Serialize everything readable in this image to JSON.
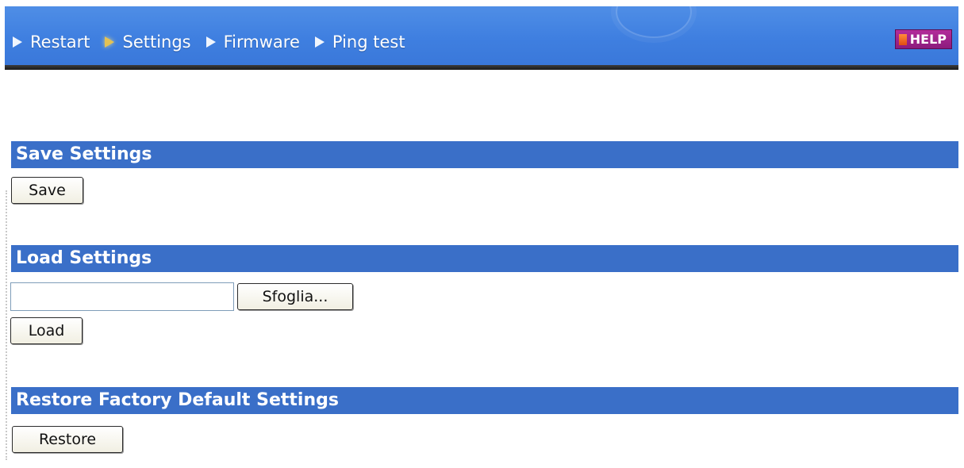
{
  "nav": {
    "items": [
      {
        "label": "Restart",
        "active": false
      },
      {
        "label": "Settings",
        "active": true
      },
      {
        "label": "Firmware",
        "active": false
      },
      {
        "label": "Ping test",
        "active": false
      }
    ],
    "help_label": "HELP"
  },
  "sections": {
    "save": {
      "title": "Save Settings",
      "button_label": "Save"
    },
    "load": {
      "title": "Load Settings",
      "file_value": "",
      "browse_label": "Sfoglia...",
      "button_label": "Load"
    },
    "restore": {
      "title": "Restore Factory Default Settings",
      "button_label": "Restore"
    }
  },
  "colors": {
    "topbar": "#3f7fe0",
    "section_header": "#3a6fc8",
    "active_arrow": "#f2c84a",
    "help_button": "#9c2288"
  }
}
